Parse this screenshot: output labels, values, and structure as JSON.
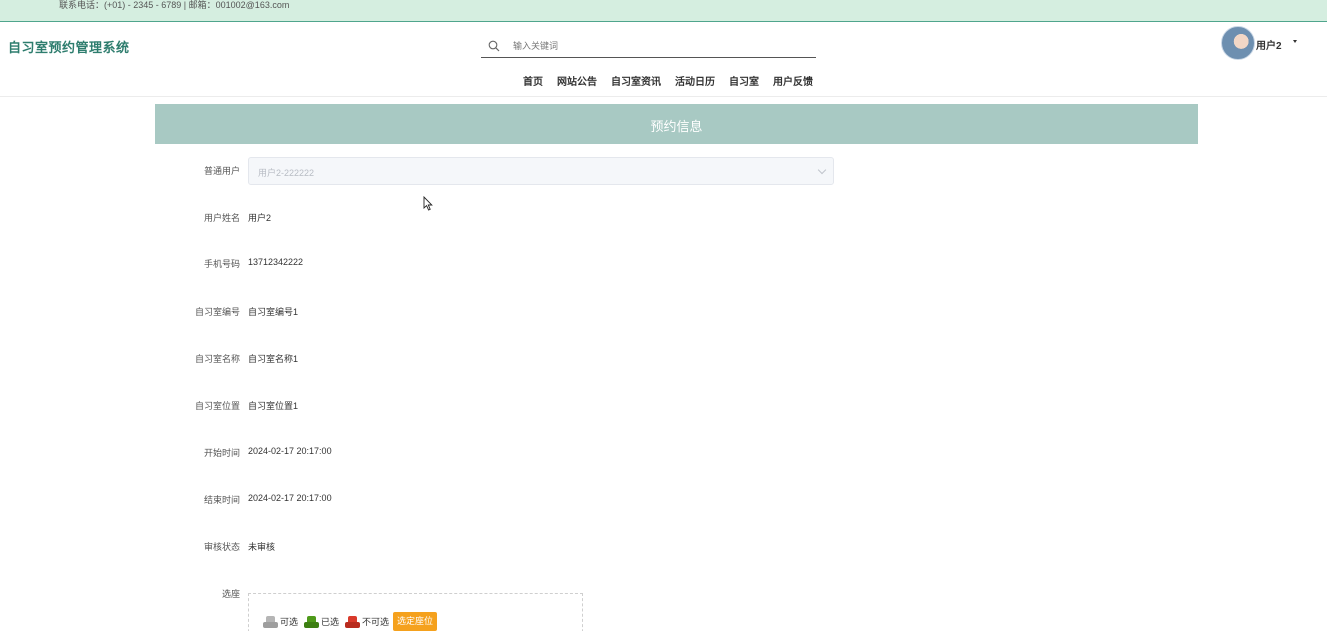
{
  "topbar": {
    "contact": "联系电话：(+01) - 2345 - 6789 | 邮箱：001002@163.com"
  },
  "header": {
    "site_title": "自习室预约管理系统",
    "search_placeholder": "输入关键词",
    "user_name": "用户2"
  },
  "nav": {
    "items": [
      {
        "label": "首页"
      },
      {
        "label": "网站公告"
      },
      {
        "label": "自习室资讯"
      },
      {
        "label": "活动日历"
      },
      {
        "label": "自习室"
      },
      {
        "label": "用户反馈"
      }
    ]
  },
  "panel": {
    "title": "预约信息"
  },
  "form": {
    "user_select": {
      "label": "普通用户",
      "value": "用户2-222222"
    },
    "fields": [
      {
        "label": "用户姓名",
        "value": "用户2"
      },
      {
        "label": "手机号码",
        "value": "13712342222"
      },
      {
        "label": "自习室编号",
        "value": "自习室编号1"
      },
      {
        "label": "自习室名称",
        "value": "自习室名称1"
      },
      {
        "label": "自习室位置",
        "value": "自习室位置1"
      },
      {
        "label": "开始时间",
        "value": "2024-02-17 20:17:00"
      },
      {
        "label": "结束时间",
        "value": "2024-02-17 20:17:00"
      },
      {
        "label": "审核状态",
        "value": "未审核"
      }
    ],
    "seat": {
      "label": "选座",
      "legend": [
        {
          "label": "可选",
          "color": "#b5b5b5"
        },
        {
          "label": "已选",
          "color": "#4e9a1a"
        },
        {
          "label": "不可选",
          "color": "#d93a2b"
        }
      ],
      "pick_button": "选定座位"
    }
  },
  "colors": {
    "accent": "#2e7d6e",
    "topbar_bg": "#d5eee0",
    "panel_header": "#a8c9c3",
    "button_orange": "#f5a11d"
  }
}
